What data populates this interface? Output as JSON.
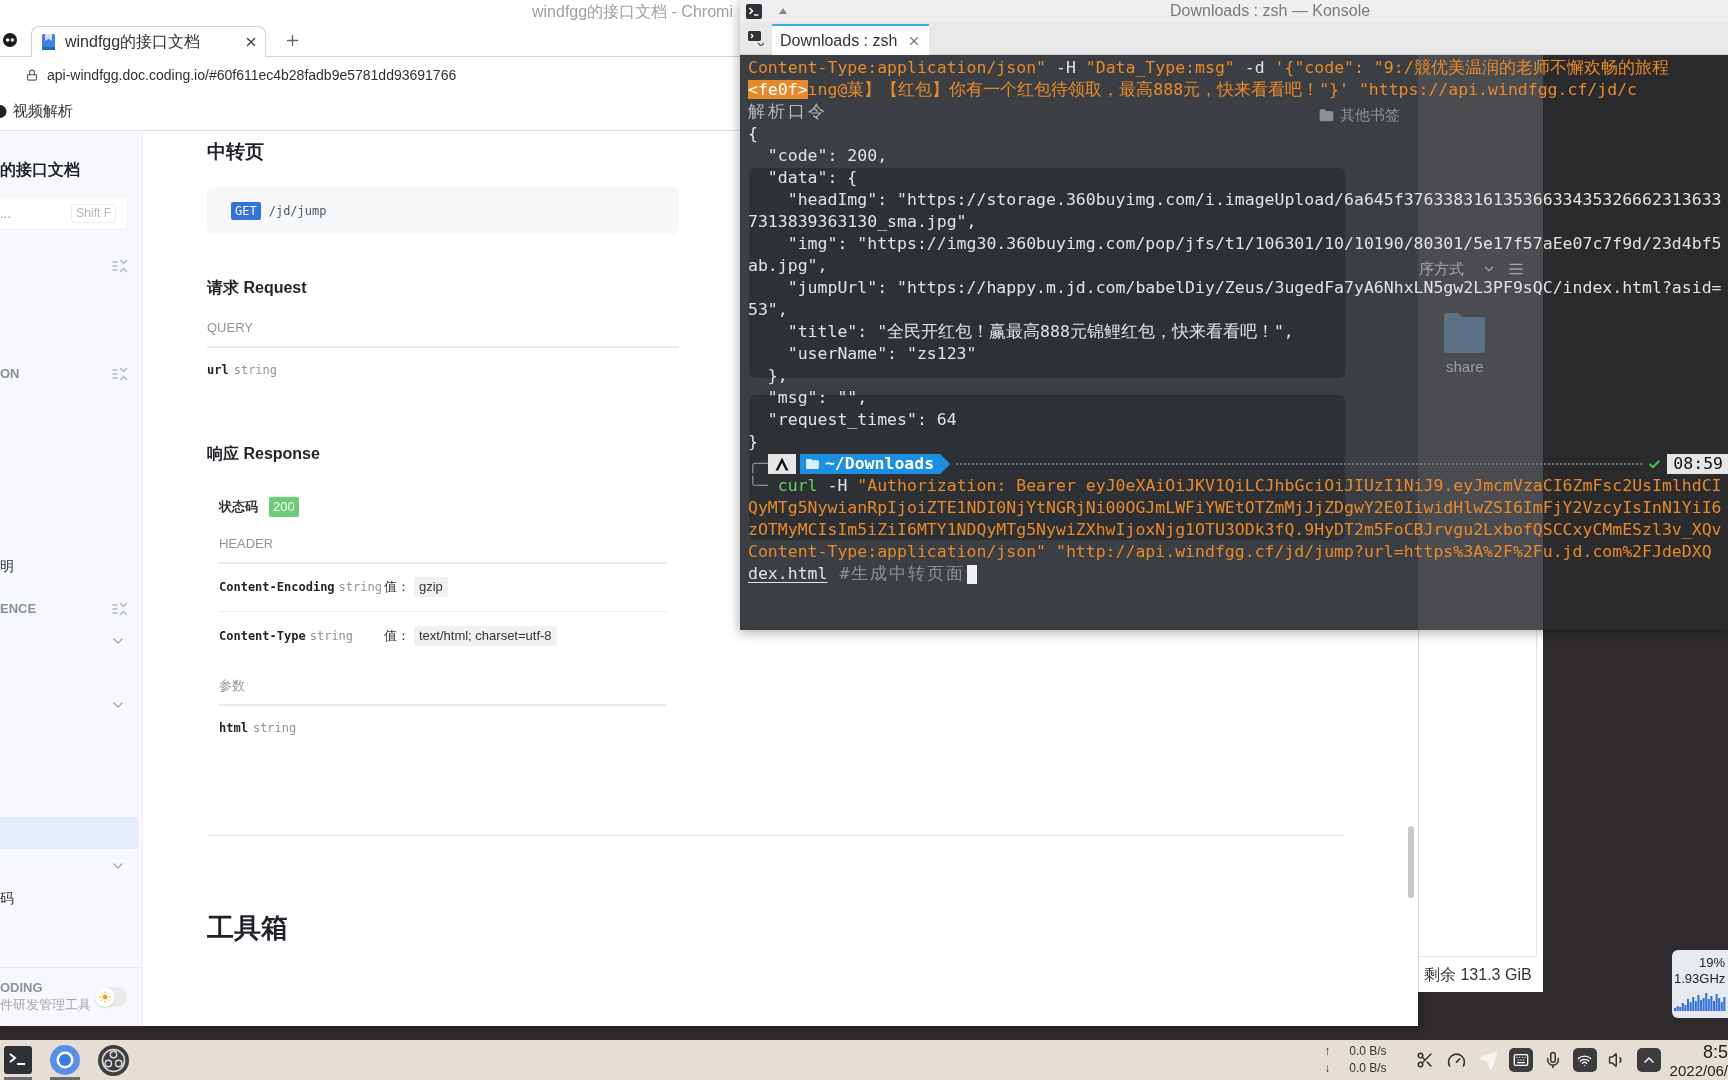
{
  "browser": {
    "window_title": "windfgg的接口文档 - Chromi",
    "tabs": [
      {
        "title": "windfgg的接口文档",
        "selected": true
      }
    ],
    "address": "api-windfgg.doc.coding.io/#60f611ec4b28fadb9e5781dd93691766",
    "bookmarks": [
      {
        "label": "视频解析"
      }
    ],
    "other_bookmarks": "其他书签"
  },
  "sidebar": {
    "title": "的接口文档",
    "search": {
      "placeholder": "...",
      "shortcut": "Shift F"
    },
    "items": [
      {
        "kind": "section"
      },
      {
        "kind": "section",
        "label": "ON"
      },
      {
        "kind": "page",
        "label": "明",
        "selected": false
      },
      {
        "kind": "section",
        "label": "ENCE"
      },
      {
        "kind": "group",
        "expanded": false
      },
      {
        "kind": "group",
        "expanded": false
      },
      {
        "kind": "page",
        "selected": true
      },
      {
        "kind": "group",
        "expanded": false
      },
      {
        "kind": "page",
        "label": "码",
        "selected": false
      }
    ],
    "footer": {
      "brand": "ODING",
      "tagline": "件研发管理工具",
      "dark_theme": false
    }
  },
  "doc": {
    "title": "中转页",
    "endpoint": {
      "method": "GET",
      "path": "/jd/jump"
    },
    "request": {
      "heading": "请求 Request",
      "group": "QUERY",
      "params": [
        {
          "name": "url",
          "type": "string"
        }
      ]
    },
    "response": {
      "heading": "响应 Response",
      "status_label": "状态码",
      "status": "200",
      "header_group": "HEADER",
      "headers": [
        {
          "name": "Content-Encoding",
          "type": "string",
          "value_label": "值：",
          "value": "gzip"
        },
        {
          "name": "Content-Type",
          "type": "string",
          "value_label": "值：",
          "value": "text/html; charset=utf-8"
        }
      ],
      "params_group": "参数",
      "params": [
        {
          "name": "html",
          "type": "string"
        }
      ]
    },
    "next_section": "工具箱"
  },
  "terminal": {
    "window_title": "Downloads : zsh — Konsole",
    "tabs": [
      {
        "title": "Downloads : zsh",
        "selected": true
      }
    ],
    "lines": [
      {
        "kind": "text",
        "segments": [
          {
            "kind": "arg",
            "text": "Content-Type:application/json\""
          },
          {
            "kind": "plain",
            "text": " -H "
          },
          {
            "kind": "arg",
            "text": "\"Data_Type:msg\""
          },
          {
            "kind": "plain",
            "text": " -d "
          },
          {
            "kind": "arg",
            "text": "'{\"code\": \"9:/競优美温润的老师不懈欢畅的旅程"
          }
        ]
      },
      {
        "kind": "text",
        "segments": [
          {
            "kind": "escape",
            "text": "<fe0f>"
          },
          {
            "kind": "arg",
            "text": "ıng@菓】【红包】你有一个红包待领取，最高888元，快来看看吧！\"}' \"https://api.windfgg.cf/jd/c"
          }
        ]
      },
      {
        "kind": "text",
        "segments": [
          {
            "kind": "output",
            "text": "解析口令"
          }
        ]
      },
      {
        "kind": "text",
        "segments": [
          {
            "kind": "plain",
            "text": "{"
          }
        ]
      },
      {
        "kind": "text",
        "segments": [
          {
            "kind": "plain",
            "text": "  \"code\": 200,"
          }
        ]
      },
      {
        "kind": "text",
        "segments": [
          {
            "kind": "plain",
            "text": "  \"data\": {"
          }
        ]
      },
      {
        "kind": "text",
        "segments": [
          {
            "kind": "plain",
            "text": "    \"headImg\": \"https://storage.360buyimg.com/i.imageUpload/6a645f37633831613536633435326662313633"
          }
        ]
      },
      {
        "kind": "text",
        "segments": [
          {
            "kind": "plain",
            "text": "7313839363130_sma.jpg\","
          }
        ]
      },
      {
        "kind": "text",
        "segments": [
          {
            "kind": "plain",
            "text": "    \"img\": \"https://img30.360buyimg.com/pop/jfs/t1/106301/10/10190/80301/5e17f57aEe07c7f9d/23d4bf5"
          }
        ]
      },
      {
        "kind": "text",
        "segments": [
          {
            "kind": "plain",
            "text": "ab.jpg\","
          }
        ]
      },
      {
        "kind": "text",
        "segments": [
          {
            "kind": "plain",
            "text": "    \"jumpUrl\": \"https://happy.m.jd.com/babelDiy/Zeus/3ugedFa7yA6NhxLN5gw2L3PF9sQC/index.html?asid="
          }
        ]
      },
      {
        "kind": "text",
        "segments": [
          {
            "kind": "plain",
            "text": "53\","
          }
        ]
      },
      {
        "kind": "text",
        "segments": [
          {
            "kind": "plain",
            "text": "    \"title\": \"全民开红包！赢最高888元锦鲤红包，快来看看吧！\","
          }
        ]
      },
      {
        "kind": "text",
        "segments": [
          {
            "kind": "plain",
            "text": "    \"userName\": \"zs123\""
          }
        ]
      },
      {
        "kind": "text",
        "segments": [
          {
            "kind": "plain",
            "text": "  },"
          }
        ]
      },
      {
        "kind": "text",
        "segments": [
          {
            "kind": "plain",
            "text": "  \"msg\": \"\","
          }
        ]
      },
      {
        "kind": "text",
        "segments": [
          {
            "kind": "plain",
            "text": "  \"request_times\": 64"
          }
        ]
      },
      {
        "kind": "text",
        "segments": [
          {
            "kind": "plain",
            "text": "}"
          }
        ]
      },
      {
        "kind": "prompt",
        "frame": "╭─",
        "directory": "~/Downloads",
        "succeeded": true,
        "time": "08:59"
      },
      {
        "kind": "text",
        "segments": [
          {
            "kind": "frame",
            "text": "╰─ "
          },
          {
            "kind": "command",
            "text": "curl"
          },
          {
            "kind": "plain",
            "text": " -H "
          },
          {
            "kind": "arg",
            "text": "\"Authorization: Bearer eyJ0eXAiOiJKV1QiLCJhbGciOiJIUzI1NiJ9.eyJmcmVzaCI6ZmFsc2UsImlhdCI"
          }
        ]
      },
      {
        "kind": "text",
        "segments": [
          {
            "kind": "arg",
            "text": "QyMTg5NywianRpIjoiZTE1NDI0NjYtNGRjNi00OGJmLWFiYWEtOTZmMjJjZDgwY2E0IiwidHlwZSI6ImFjY2VzcyIsInN1YiI6"
          }
        ]
      },
      {
        "kind": "text",
        "segments": [
          {
            "kind": "arg",
            "text": "zOTMyMCIsIm5iZiI6MTY1NDQyMTg5NywiZXhwIjoxNjg1OTU3ODk3fQ.9HyDT2m5FoCBJrvgu2LxbofQSCCxyCMmESzl3v_XQv"
          }
        ]
      },
      {
        "kind": "text",
        "segments": [
          {
            "kind": "arg",
            "text": "Content-Type:application/json\" \"http://api.windfgg.cf/jd/jump?url=https%3A%2F%2Fu.jd.com%2FJdeDXQ"
          }
        ]
      },
      {
        "kind": "text",
        "segments": [
          {
            "kind": "path",
            "text": "dex.html"
          },
          {
            "kind": "comment",
            "text": " #生成中转页面"
          }
        ],
        "cursor": true
      }
    ]
  },
  "file_manager": {
    "sort_label": "序方式",
    "folders": [
      {
        "name": "share"
      }
    ],
    "free_space": "剩余 131.3 GiB"
  },
  "cpu_widget": {
    "usage": "19%",
    "clock": "1.93GHz"
  },
  "taskbar": {
    "apps": [
      {
        "kind": "terminal",
        "active": true
      },
      {
        "kind": "browser",
        "active": true
      },
      {
        "kind": "recorder",
        "active": false
      }
    ],
    "net_speed": [
      {
        "arrow": "↑",
        "rate": "0.0 B/s"
      },
      {
        "arrow": "↓",
        "rate": "0.0 B/s"
      }
    ],
    "clock": {
      "time": "8:5",
      "date": "2022/06/"
    }
  }
}
